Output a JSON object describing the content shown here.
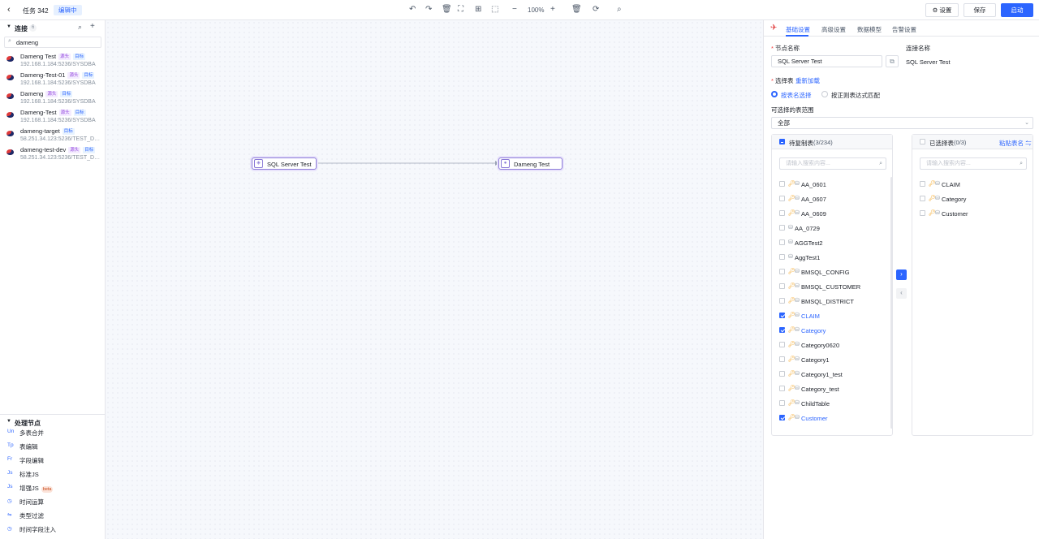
{
  "topbar": {
    "back_icon": "chevron-left-icon",
    "title": "任务 342",
    "status": "编辑中",
    "zoom": "100%",
    "settings_label": "⚙ 设置",
    "save_label": "保存",
    "start_label": "启动"
  },
  "connections": {
    "title": "连接",
    "count": "6",
    "search_value": "dameng",
    "items": [
      {
        "name": "Dameng Test",
        "tags": [
          "源头",
          "目标"
        ],
        "addr": "192.168.1.184:5236/SYSDBA"
      },
      {
        "name": "Dameng-Test-01",
        "tags": [
          "源头",
          "目标"
        ],
        "addr": "192.168.1.184:5236/SYSDBA"
      },
      {
        "name": "Dameng",
        "tags": [
          "源头",
          "目标"
        ],
        "addr": "192.168.1.184:5236/SYSDBA"
      },
      {
        "name": "Dameng-Test",
        "tags": [
          "源头",
          "目标"
        ],
        "addr": "192.168.1.184:5236/SYSDBA"
      },
      {
        "name": "dameng-target",
        "tags": [
          "目标"
        ],
        "addr": "58.251.34.123:5236/TEST_DAMENG"
      },
      {
        "name": "dameng-test-dev",
        "tags": [
          "源头",
          "目标"
        ],
        "addr": "58.251.34.123:5236/TEST_DAMENG"
      }
    ]
  },
  "process_nodes": {
    "title": "处理节点",
    "items": [
      {
        "icon": "Un",
        "label": "多表合并"
      },
      {
        "icon": "Tp",
        "label": "表编辑"
      },
      {
        "icon": "Fr",
        "label": "字段编辑"
      },
      {
        "icon": "Js",
        "label": "标准JS"
      },
      {
        "icon": "Js",
        "label": "增强JS",
        "badge": "beta"
      },
      {
        "icon": "◷",
        "label": "时间运算"
      },
      {
        "icon": "⇋",
        "label": "类型过滤"
      },
      {
        "icon": "◷",
        "label": "时间字段注入"
      }
    ]
  },
  "canvas": {
    "source_node": "SQL Server Test",
    "target_node": "Dameng Test"
  },
  "panel": {
    "tabs": [
      "基础设置",
      "高级设置",
      "数据模型",
      "告警设置"
    ],
    "node_name_label": "节点名称",
    "node_name_value": "SQL Server Test",
    "conn_name_label": "连接名称",
    "conn_name_value": "SQL Server Test",
    "select_table_label": "选择表",
    "reload_label": "重新加载",
    "radio_by_name": "按表名选择",
    "radio_by_regex": "按正则表达式匹配",
    "range_label": "可选择的表范围",
    "range_value": "全部",
    "left_list": {
      "title": "待复制表",
      "count": "(3/234)",
      "search_placeholder": "请输入搜索内容...",
      "items": [
        {
          "name": "AA_0601",
          "key": true,
          "checked": false
        },
        {
          "name": "AA_0607",
          "key": true,
          "checked": false
        },
        {
          "name": "AA_0609",
          "key": true,
          "checked": false
        },
        {
          "name": "AA_0729",
          "key": false,
          "checked": false
        },
        {
          "name": "AGGTest2",
          "key": false,
          "checked": false
        },
        {
          "name": "AggTest1",
          "key": false,
          "checked": false
        },
        {
          "name": "BMSQL_CONFIG",
          "key": true,
          "checked": false
        },
        {
          "name": "BMSQL_CUSTOMER",
          "key": true,
          "checked": false
        },
        {
          "name": "BMSQL_DISTRICT",
          "key": true,
          "checked": false
        },
        {
          "name": "CLAIM",
          "key": true,
          "checked": true
        },
        {
          "name": "Category",
          "key": true,
          "checked": true
        },
        {
          "name": "Category0620",
          "key": true,
          "checked": false
        },
        {
          "name": "Category1",
          "key": true,
          "checked": false
        },
        {
          "name": "Category1_test",
          "key": true,
          "checked": false
        },
        {
          "name": "Category_test",
          "key": true,
          "checked": false
        },
        {
          "name": "ChildTable",
          "key": true,
          "checked": false
        },
        {
          "name": "Customer",
          "key": true,
          "checked": true
        }
      ]
    },
    "right_list": {
      "title": "已选择表",
      "count": "(0/3)",
      "paste_label": "粘贴表名 ⇋",
      "search_placeholder": "请输入搜索内容...",
      "items": [
        {
          "name": "CLAIM",
          "key": true
        },
        {
          "name": "Category",
          "key": true
        },
        {
          "name": "Customer",
          "key": true
        }
      ]
    }
  }
}
